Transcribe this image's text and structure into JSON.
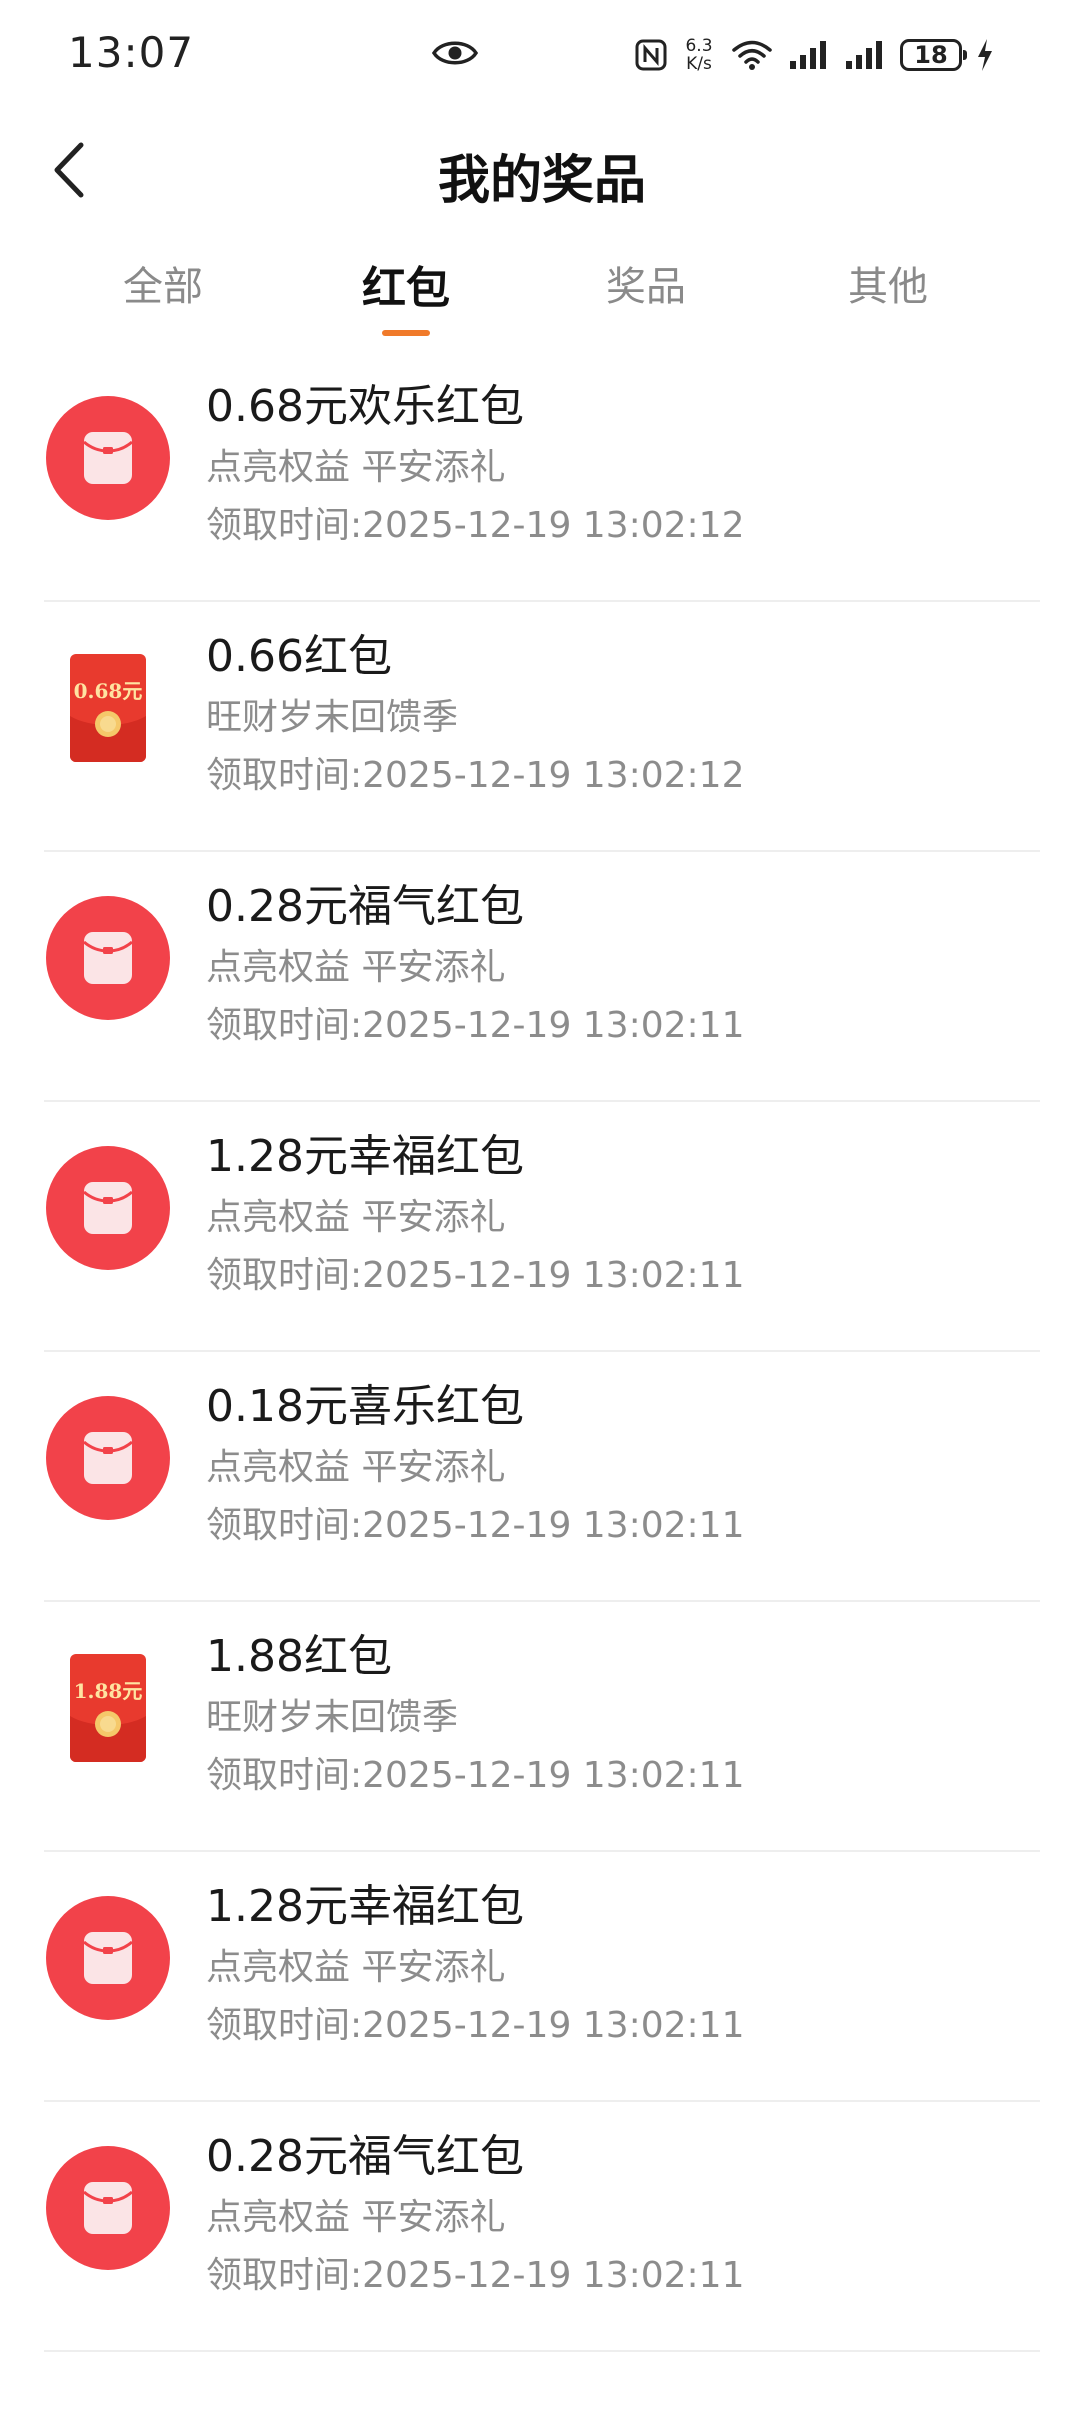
{
  "status": {
    "time": "13:07",
    "net_speed_value": "6.3",
    "net_speed_unit": "K/s",
    "battery": "18"
  },
  "header": {
    "title": "我的奖品"
  },
  "tabs": [
    {
      "label": "全部"
    },
    {
      "label": "红包"
    },
    {
      "label": "奖品"
    },
    {
      "label": "其他"
    }
  ],
  "active_tab": "红包",
  "colors": {
    "accent": "#f07a2a",
    "red": "#f2424a"
  },
  "items": [
    {
      "title": "0.68元欢乐红包",
      "source": "点亮权益 平安添礼",
      "time": "领取时间:2025-12-19 13:02:12",
      "icon": "round-red-envelope-icon"
    },
    {
      "title": "0.66红包",
      "source": "旺财岁末回馈季",
      "time": "领取时间:2025-12-19 13:02:12",
      "icon": "red-envelope-ticket-icon",
      "ticket_amount": "0.68元"
    },
    {
      "title": "0.28元福气红包",
      "source": "点亮权益 平安添礼",
      "time": "领取时间:2025-12-19 13:02:11",
      "icon": "round-red-envelope-icon"
    },
    {
      "title": "1.28元幸福红包",
      "source": "点亮权益 平安添礼",
      "time": "领取时间:2025-12-19 13:02:11",
      "icon": "round-red-envelope-icon"
    },
    {
      "title": "0.18元喜乐红包",
      "source": "点亮权益 平安添礼",
      "time": "领取时间:2025-12-19 13:02:11",
      "icon": "round-red-envelope-icon"
    },
    {
      "title": "1.88红包",
      "source": "旺财岁末回馈季",
      "time": "领取时间:2025-12-19 13:02:11",
      "icon": "red-envelope-ticket-icon",
      "ticket_amount": "1.88元"
    },
    {
      "title": "1.28元幸福红包",
      "source": "点亮权益 平安添礼",
      "time": "领取时间:2025-12-19 13:02:11",
      "icon": "round-red-envelope-icon"
    },
    {
      "title": "0.28元福气红包",
      "source": "点亮权益 平安添礼",
      "time": "领取时间:2025-12-19 13:02:11",
      "icon": "round-red-envelope-icon"
    }
  ]
}
